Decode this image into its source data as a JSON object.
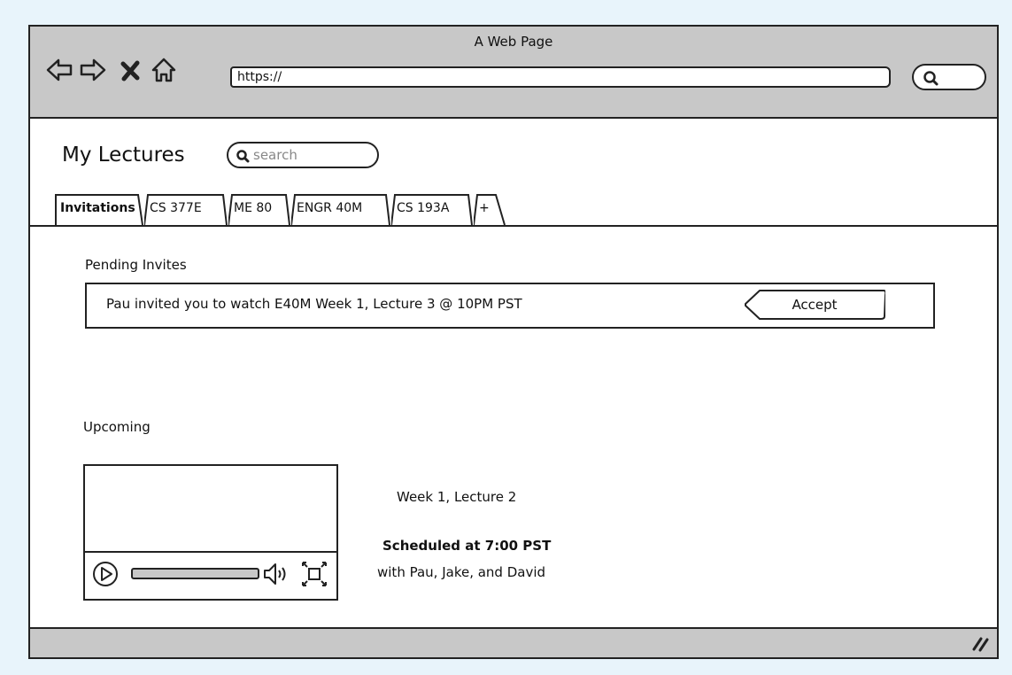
{
  "window": {
    "title": "A Web Page",
    "url": "https://"
  },
  "page": {
    "title": "My Lectures",
    "search_placeholder": "search"
  },
  "tabs": [
    {
      "label": "Invitations",
      "active": true
    },
    {
      "label": "CS 377E"
    },
    {
      "label": "ME 80"
    },
    {
      "label": "ENGR 40M"
    },
    {
      "label": "CS 193A"
    },
    {
      "label": "+"
    }
  ],
  "pending": {
    "heading": "Pending Invites",
    "invite_text": "Pau invited you to watch E40M Week 1, Lecture 3 @ 10PM PST",
    "accept_label": "Accept"
  },
  "upcoming": {
    "heading": "Upcoming",
    "lecture_title": "Week 1, Lecture 2",
    "schedule": "Scheduled at 7:00 PST",
    "participants": "with Pau, Jake, and David"
  },
  "icons": [
    "back-arrow-icon",
    "forward-arrow-icon",
    "stop-icon",
    "home-icon",
    "search-icon",
    "play-icon",
    "volume-icon",
    "fullscreen-icon",
    "resize-grip-icon"
  ]
}
